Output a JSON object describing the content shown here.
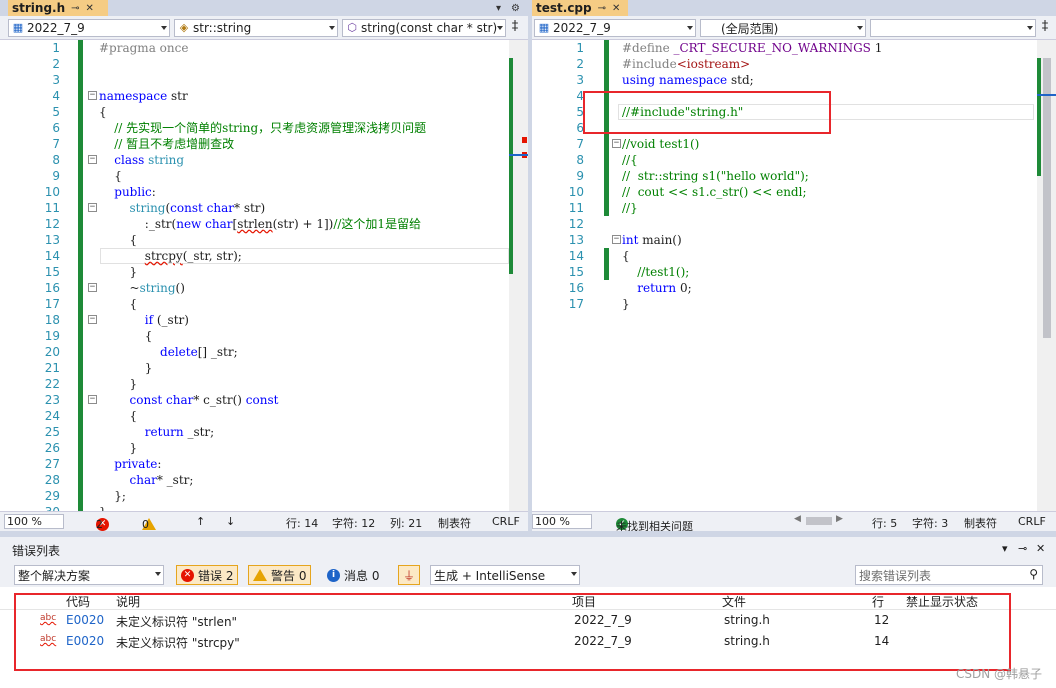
{
  "left": {
    "tab": {
      "title": "string.h",
      "pin": "⊸",
      "close": "✕"
    },
    "tab_tail": {
      "dropdown": "▾",
      "settings": "⚙"
    },
    "nav": {
      "project": "2022_7_9",
      "scope": "str::string",
      "member": "string(const char * str)"
    },
    "lines": [
      {
        "n": "1",
        "html": "<span class='pp'>#pragma once</span>"
      },
      {
        "n": "2",
        "html": ""
      },
      {
        "n": "3",
        "html": ""
      },
      {
        "n": "4",
        "html": "<span class='kw'>namespace</span> str"
      },
      {
        "n": "5",
        "html": "{"
      },
      {
        "n": "6",
        "html": "    <span class='cm'>// 先实现一个简单的string，只考虑资源管理深浅拷贝问题</span>"
      },
      {
        "n": "7",
        "html": "    <span class='cm'>// 暂且不考虑增删查改</span>"
      },
      {
        "n": "8",
        "html": "    <span class='kw'>class</span> <span class='ty'>string</span>"
      },
      {
        "n": "9",
        "html": "    {"
      },
      {
        "n": "10",
        "html": "    <span class='kw'>public</span>:"
      },
      {
        "n": "11",
        "html": "        <span class='ty'>string</span>(<span class='kw'>const</span> <span class='kw'>char</span>* str)"
      },
      {
        "n": "12",
        "html": "            :_str(<span class='kw'>new</span> <span class='kw'>char</span>[<span class='sq'>strlen</span>(str) + 1])<span class='cm'>//这个加1是留给</span>"
      },
      {
        "n": "13",
        "html": "        {"
      },
      {
        "n": "14",
        "html": "            <span class='sq'>strcpy</span>(_str, str);"
      },
      {
        "n": "15",
        "html": "        }"
      },
      {
        "n": "16",
        "html": "        ~<span class='ty'>string</span>()"
      },
      {
        "n": "17",
        "html": "        {"
      },
      {
        "n": "18",
        "html": "            <span class='kw'>if</span> (_str)"
      },
      {
        "n": "19",
        "html": "            {"
      },
      {
        "n": "20",
        "html": "                <span class='kw'>delete</span>[] _str;"
      },
      {
        "n": "21",
        "html": "            }"
      },
      {
        "n": "22",
        "html": "        }"
      },
      {
        "n": "23",
        "html": "        <span class='kw'>const</span> <span class='kw'>char</span>* c_str() <span class='kw'>const</span>"
      },
      {
        "n": "24",
        "html": "        {"
      },
      {
        "n": "25",
        "html": "            <span class='kw'>return</span> _str;"
      },
      {
        "n": "26",
        "html": "        }"
      },
      {
        "n": "27",
        "html": "    <span class='kw'>private</span>:"
      },
      {
        "n": "28",
        "html": "        <span class='kw'>char</span>* _str;"
      },
      {
        "n": "29",
        "html": "    };"
      },
      {
        "n": "30",
        "html": "}"
      }
    ],
    "status": {
      "zoom": "100 %",
      "errors": "2",
      "warnings": "0",
      "up": "↑",
      "down": "↓",
      "line": "行: 14",
      "char": "字符: 12",
      "col": "列: 21",
      "tab": "制表符",
      "eol": "CRLF"
    }
  },
  "right": {
    "tab": {
      "title": "test.cpp",
      "pin": "⊸",
      "close": "✕"
    },
    "nav": {
      "project": "2022_7_9",
      "scope": "(全局范围)",
      "member": ""
    },
    "lines": [
      {
        "n": "1",
        "html": "<span class='pp'>#define</span> <span class='mac'>_CRT_SECURE_NO_WARNINGS</span> 1"
      },
      {
        "n": "2",
        "html": "<span class='pp'>#include</span><span class='st'>&lt;iostream&gt;</span>"
      },
      {
        "n": "3",
        "html": "<span class='kw'>using</span> <span class='kw'>namespace</span> std;"
      },
      {
        "n": "4",
        "html": ""
      },
      {
        "n": "5",
        "html": "<span class='cm'>//#include\"string.h\"</span>"
      },
      {
        "n": "6",
        "html": ""
      },
      {
        "n": "7",
        "html": "<span class='cm'>//void test1()</span>"
      },
      {
        "n": "8",
        "html": "<span class='cm'>//{</span>"
      },
      {
        "n": "9",
        "html": "<span class='cm'>//  str::string s1(\"hello world\");</span>"
      },
      {
        "n": "10",
        "html": "<span class='cm'>//  cout &lt;&lt; s1.c_str() &lt;&lt; endl;</span>"
      },
      {
        "n": "11",
        "html": "<span class='cm'>//}</span>"
      },
      {
        "n": "12",
        "html": ""
      },
      {
        "n": "13",
        "html": "<span class='kw'>int</span> main()"
      },
      {
        "n": "14",
        "html": "{"
      },
      {
        "n": "15",
        "html": "    <span class='cm'>//test1();</span>"
      },
      {
        "n": "16",
        "html": "    <span class='kw'>return</span> 0;"
      },
      {
        "n": "17",
        "html": "}"
      }
    ],
    "status": {
      "zoom": "100 %",
      "issues": "未找到相关问题",
      "line": "行: 5",
      "char": "字符: 3",
      "tab": "制表符",
      "eol": "CRLF"
    }
  },
  "errors": {
    "title": "错误列表",
    "title_controls": {
      "dropdown": "▾",
      "pin": "⊸",
      "close": "✕"
    },
    "scope": "整个解决方案",
    "err_btn": "错误 2",
    "warn_btn": "警告 0",
    "info_btn": "消息 0",
    "build_filter": "生成 + IntelliSense",
    "search_placeholder": "搜索错误列表",
    "columns": {
      "code": "代码",
      "desc": "说明",
      "project": "项目",
      "file": "文件",
      "line": "行",
      "suppress": "禁止显示状态"
    },
    "rows": [
      {
        "icon": "abc",
        "code": "E0020",
        "desc": "未定义标识符 \"strlen\"",
        "project": "2022_7_9",
        "file": "string.h",
        "line": "12"
      },
      {
        "icon": "abc",
        "code": "E0020",
        "desc": "未定义标识符 \"strcpy\"",
        "project": "2022_7_9",
        "file": "string.h",
        "line": "14"
      }
    ]
  },
  "watermark": "CSDN @韩悬子"
}
